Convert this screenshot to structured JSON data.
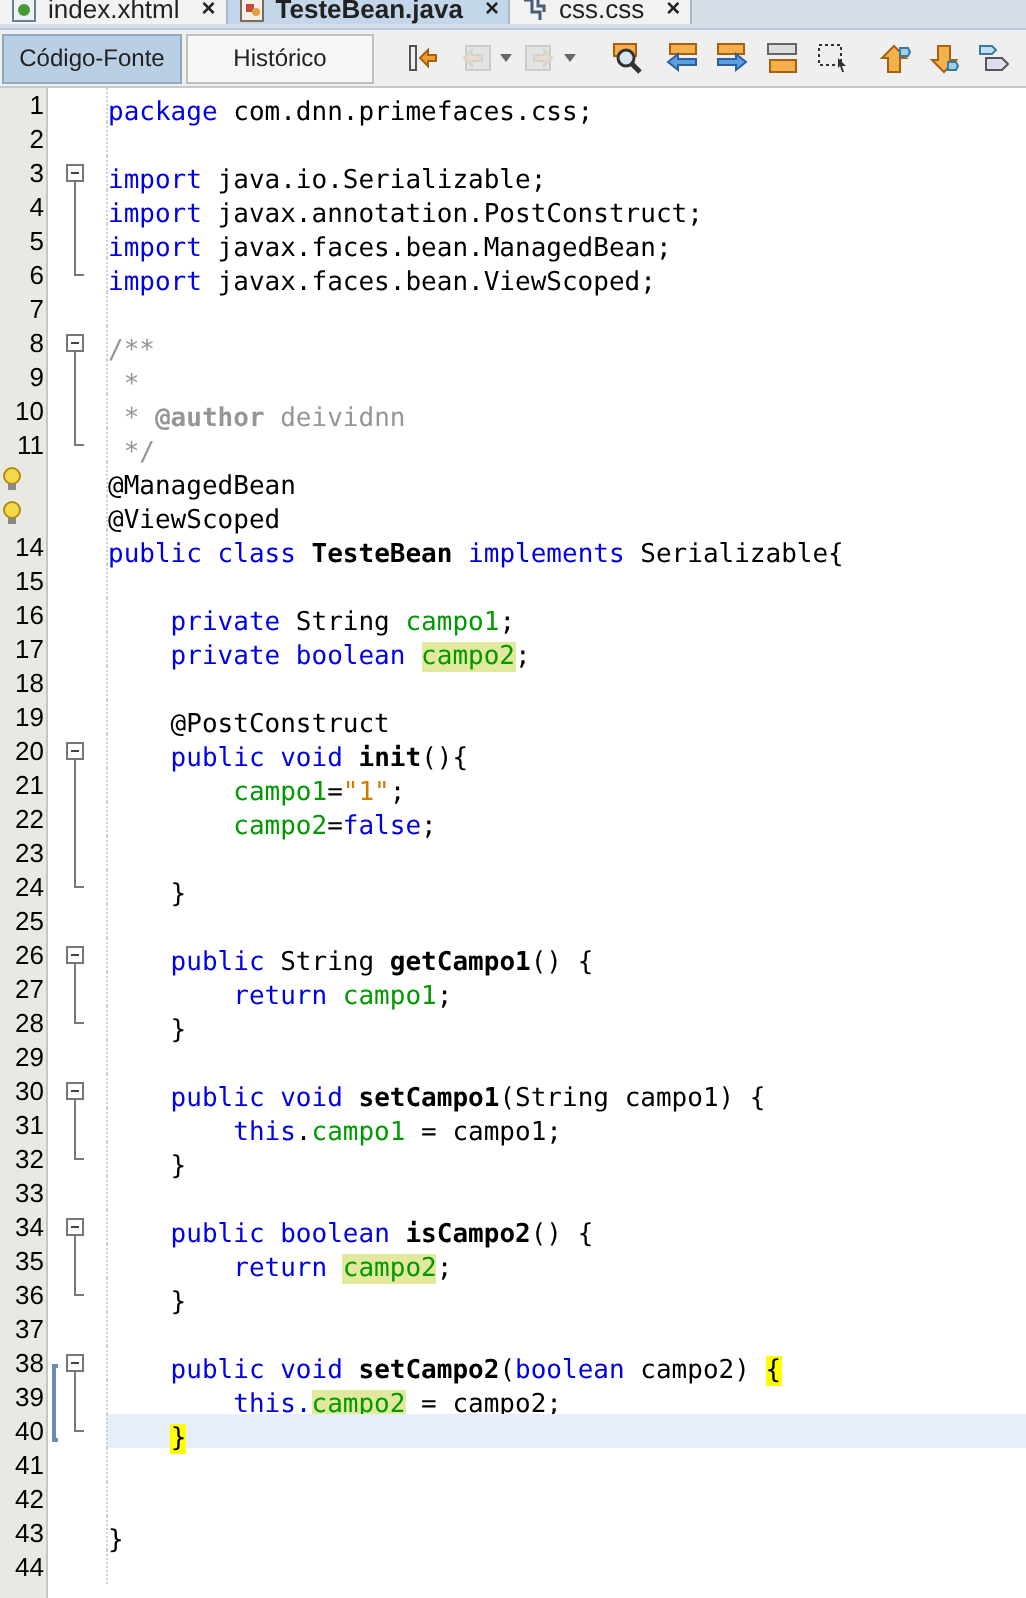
{
  "file_tabs": [
    {
      "label": "index.xhtml",
      "close": "×",
      "kind": "page",
      "selected": false
    },
    {
      "label": "TesteBean.java",
      "close": "×",
      "kind": "java",
      "selected": true
    },
    {
      "label": "css.css",
      "close": "×",
      "kind": "css",
      "selected": false
    }
  ],
  "view_tabs": [
    {
      "label": "Código-Fonte",
      "selected": true
    },
    {
      "label": "Histórico",
      "selected": false
    }
  ],
  "toolbar": [
    {
      "kind": "jump",
      "disabled": false
    },
    {
      "kind": "back",
      "disabled": true,
      "dropdown": true
    },
    {
      "kind": "forward",
      "disabled": true,
      "dropdown": true
    },
    {
      "kind": "find",
      "disabled": false
    },
    {
      "kind": "prev",
      "disabled": false
    },
    {
      "kind": "next",
      "disabled": false
    },
    {
      "kind": "toggle",
      "disabled": false
    },
    {
      "kind": "select",
      "disabled": false
    },
    {
      "kind": "up",
      "disabled": false
    },
    {
      "kind": "down",
      "disabled": false
    },
    {
      "kind": "bookmark",
      "disabled": false
    }
  ],
  "lines": [
    {
      "number": "1",
      "tokens": [
        {
          "kind": "keyword",
          "text": "package"
        },
        {
          "kind": "plain",
          "text": " com.dnn.primefaces.css;"
        }
      ]
    },
    {
      "number": "2"
    },
    {
      "number": "3",
      "fold": {
        "kind": "start"
      },
      "tokens": [
        {
          "kind": "keyword",
          "text": "import"
        },
        {
          "kind": "plain",
          "text": " java.io.Serializable;"
        }
      ]
    },
    {
      "number": "4",
      "fold": {
        "kind": "mid"
      },
      "tokens": [
        {
          "kind": "keyword",
          "text": "import"
        },
        {
          "kind": "plain",
          "text": " javax.annotation.PostConstruct;"
        }
      ]
    },
    {
      "number": "5",
      "fold": {
        "kind": "mid"
      },
      "tokens": [
        {
          "kind": "keyword",
          "text": "import"
        },
        {
          "kind": "plain",
          "text": " javax.faces.bean.ManagedBean;"
        }
      ]
    },
    {
      "number": "6",
      "fold": {
        "kind": "end"
      },
      "tokens": [
        {
          "kind": "keyword",
          "text": "import"
        },
        {
          "kind": "plain",
          "text": " javax.faces.bean.ViewScoped;"
        }
      ]
    },
    {
      "number": "7"
    },
    {
      "number": "8",
      "fold": {
        "kind": "start"
      },
      "tokens": [
        {
          "kind": "comment",
          "text": "/**"
        }
      ]
    },
    {
      "number": "9",
      "fold": {
        "kind": "mid"
      },
      "tokens": [
        {
          "kind": "comment",
          "text": " *"
        }
      ]
    },
    {
      "number": "10",
      "fold": {
        "kind": "mid"
      },
      "tokens": [
        {
          "kind": "comment",
          "text": " *"
        },
        {
          "kind": "doc_tag",
          "text": " @author"
        },
        {
          "kind": "comment",
          "text": " deividnn"
        }
      ]
    },
    {
      "number": "11",
      "fold": {
        "kind": "end"
      },
      "tokens": [
        {
          "kind": "comment",
          "text": " */"
        }
      ]
    },
    {
      "hint": true,
      "tokens": [
        {
          "kind": "plain",
          "text": "@ManagedBean"
        }
      ]
    },
    {
      "hint": true,
      "tokens": [
        {
          "kind": "plain",
          "text": "@ViewScoped"
        }
      ]
    },
    {
      "number": "14",
      "tokens": [
        {
          "kind": "keyword",
          "text": "public"
        },
        {
          "kind": "keyword",
          "text": " class"
        },
        {
          "kind": "declaration",
          "text": " TesteBean"
        },
        {
          "kind": "keyword",
          "text": " implements"
        },
        {
          "kind": "plain",
          "text": " Serializable{"
        }
      ]
    },
    {
      "number": "15"
    },
    {
      "number": "16",
      "tokens": [
        {
          "kind": "keyword",
          "text": "    private"
        },
        {
          "kind": "plain",
          "text": " String"
        },
        {
          "kind": "field",
          "text": " campo1"
        },
        {
          "kind": "plain",
          "text": ";"
        }
      ]
    },
    {
      "number": "17",
      "tokens": [
        {
          "kind": "keyword",
          "text": "    private"
        },
        {
          "kind": "keyword",
          "text": " boolean "
        },
        {
          "kind": "field",
          "text": "campo2",
          "occurrence": true
        },
        {
          "kind": "plain",
          "text": ";"
        }
      ]
    },
    {
      "number": "18"
    },
    {
      "number": "19",
      "tokens": [
        {
          "kind": "plain",
          "text": "    @PostConstruct"
        }
      ]
    },
    {
      "number": "20",
      "fold": {
        "kind": "start"
      },
      "tokens": [
        {
          "kind": "keyword",
          "text": "    public"
        },
        {
          "kind": "keyword",
          "text": " void"
        },
        {
          "kind": "declaration",
          "text": " init"
        },
        {
          "kind": "plain",
          "text": "(){"
        }
      ]
    },
    {
      "number": "21",
      "fold": {
        "kind": "mid"
      },
      "tokens": [
        {
          "kind": "field",
          "text": "        campo1"
        },
        {
          "kind": "plain",
          "text": "="
        },
        {
          "kind": "string",
          "text": "\"1\""
        },
        {
          "kind": "plain",
          "text": ";"
        }
      ]
    },
    {
      "number": "22",
      "fold": {
        "kind": "mid"
      },
      "tokens": [
        {
          "kind": "field",
          "text": "        campo2"
        },
        {
          "kind": "plain",
          "text": "="
        },
        {
          "kind": "keyword",
          "text": "false"
        },
        {
          "kind": "plain",
          "text": ";"
        }
      ]
    },
    {
      "number": "23",
      "fold": {
        "kind": "mid"
      }
    },
    {
      "number": "24",
      "fold": {
        "kind": "end"
      },
      "tokens": [
        {
          "kind": "plain",
          "text": "    }"
        }
      ]
    },
    {
      "number": "25"
    },
    {
      "number": "26",
      "fold": {
        "kind": "start"
      },
      "tokens": [
        {
          "kind": "keyword",
          "text": "    public"
        },
        {
          "kind": "plain",
          "text": " String"
        },
        {
          "kind": "declaration",
          "text": " getCampo1"
        },
        {
          "kind": "plain",
          "text": "() {"
        }
      ]
    },
    {
      "number": "27",
      "fold": {
        "kind": "mid"
      },
      "tokens": [
        {
          "kind": "keyword",
          "text": "        return"
        },
        {
          "kind": "field",
          "text": " campo1"
        },
        {
          "kind": "plain",
          "text": ";"
        }
      ]
    },
    {
      "number": "28",
      "fold": {
        "kind": "end"
      },
      "tokens": [
        {
          "kind": "plain",
          "text": "    }"
        }
      ]
    },
    {
      "number": "29"
    },
    {
      "number": "30",
      "fold": {
        "kind": "start"
      },
      "tokens": [
        {
          "kind": "keyword",
          "text": "    public"
        },
        {
          "kind": "keyword",
          "text": " void"
        },
        {
          "kind": "declaration",
          "text": " setCampo1"
        },
        {
          "kind": "plain",
          "text": "(String campo1) {"
        }
      ]
    },
    {
      "number": "31",
      "fold": {
        "kind": "mid"
      },
      "tokens": [
        {
          "kind": "keyword",
          "text": "        this"
        },
        {
          "kind": "plain",
          "text": "."
        },
        {
          "kind": "field",
          "text": "campo1"
        },
        {
          "kind": "plain",
          "text": " = campo1;"
        }
      ]
    },
    {
      "number": "32",
      "fold": {
        "kind": "end"
      },
      "tokens": [
        {
          "kind": "plain",
          "text": "    }"
        }
      ]
    },
    {
      "number": "33"
    },
    {
      "number": "34",
      "fold": {
        "kind": "start"
      },
      "tokens": [
        {
          "kind": "keyword",
          "text": "    public"
        },
        {
          "kind": "keyword",
          "text": " boolean"
        },
        {
          "kind": "declaration",
          "text": " isCampo2"
        },
        {
          "kind": "plain",
          "text": "() {"
        }
      ]
    },
    {
      "number": "35",
      "fold": {
        "kind": "mid"
      },
      "tokens": [
        {
          "kind": "keyword",
          "text": "        return "
        },
        {
          "kind": "field",
          "text": "campo2",
          "occurrence": true
        },
        {
          "kind": "plain",
          "text": ";"
        }
      ]
    },
    {
      "number": "36",
      "fold": {
        "kind": "end"
      },
      "tokens": [
        {
          "kind": "plain",
          "text": "    }"
        }
      ]
    },
    {
      "number": "37"
    },
    {
      "number": "38",
      "fold": {
        "kind": "start"
      },
      "scope": true,
      "tokens": [
        {
          "kind": "keyword",
          "text": "    public"
        },
        {
          "kind": "keyword",
          "text": " void"
        },
        {
          "kind": "declaration",
          "text": " setCampo2"
        },
        {
          "kind": "plain",
          "text": "("
        },
        {
          "kind": "keyword",
          "text": "boolean"
        },
        {
          "kind": "plain",
          "text": " campo2) "
        },
        {
          "kind": "plain",
          "text": "{",
          "brace_match": true
        }
      ]
    },
    {
      "number": "39",
      "fold": {
        "kind": "mid"
      },
      "scope": true,
      "tokens": [
        {
          "kind": "keyword",
          "text": "        this."
        },
        {
          "kind": "field",
          "text": "campo2",
          "occurrence": true
        },
        {
          "kind": "plain",
          "text": " = campo2;"
        }
      ]
    },
    {
      "number": "40",
      "fold": {
        "kind": "end"
      },
      "scope": true,
      "current": true,
      "tokens": [
        {
          "kind": "plain",
          "text": "    }",
          "brace_match": true
        }
      ]
    },
    {
      "number": "41"
    },
    {
      "number": "42"
    },
    {
      "number": "43",
      "tokens": [
        {
          "kind": "plain",
          "text": "}"
        }
      ]
    },
    {
      "number": "44"
    }
  ]
}
